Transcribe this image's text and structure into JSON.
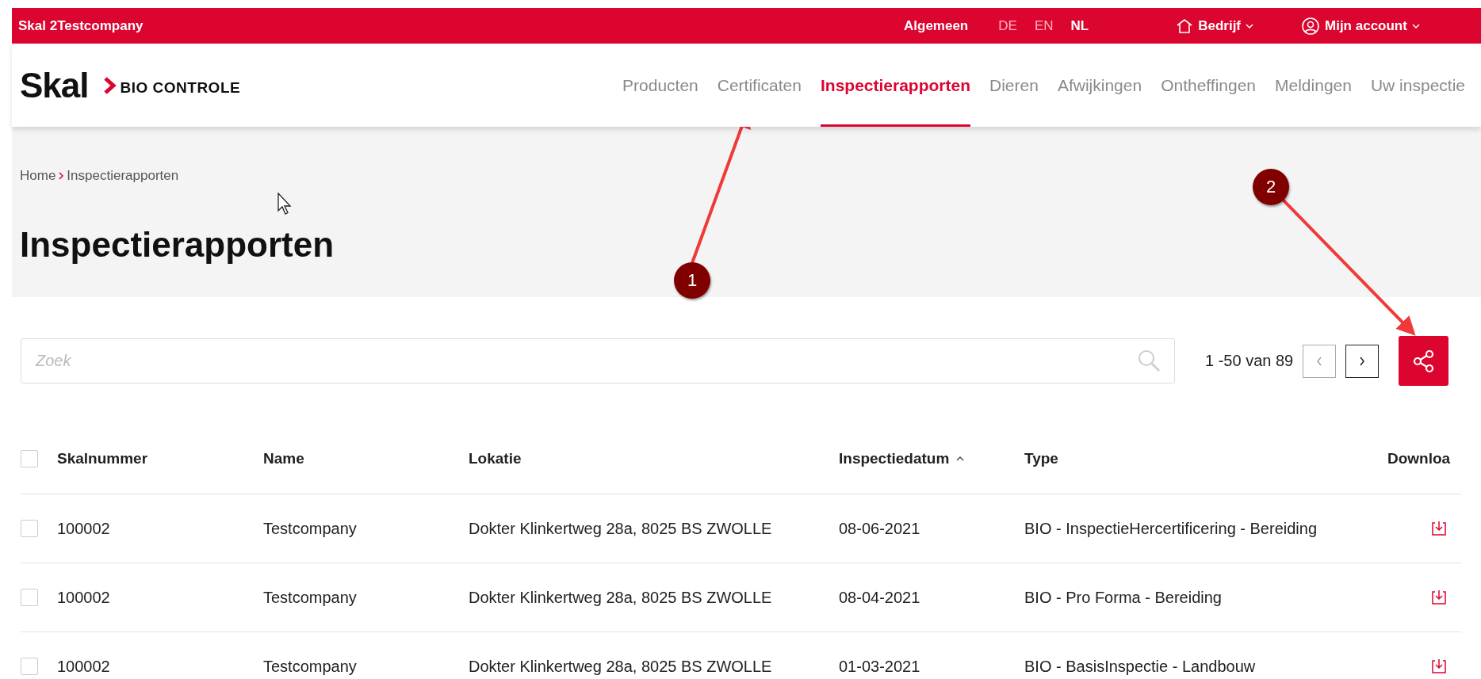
{
  "top_bar": {
    "company": "Skal 2Testcompany",
    "general": "Algemeen",
    "languages": [
      {
        "label": "DE",
        "selected": false
      },
      {
        "label": "EN",
        "selected": false
      },
      {
        "label": "NL",
        "selected": true
      }
    ],
    "company_menu": "Bedrijf",
    "account_menu": "Mijn account"
  },
  "logo": {
    "name": "Skal",
    "tagline": "BIO CONTROLE"
  },
  "nav": [
    {
      "label": "Producten",
      "selected": false
    },
    {
      "label": "Certificaten",
      "selected": false
    },
    {
      "label": "Inspectierapporten",
      "selected": true
    },
    {
      "label": "Dieren",
      "selected": false
    },
    {
      "label": "Afwijkingen",
      "selected": false
    },
    {
      "label": "Ontheffingen",
      "selected": false
    },
    {
      "label": "Meldingen",
      "selected": false
    },
    {
      "label": "Uw inspectie",
      "selected": false
    }
  ],
  "breadcrumb": [
    "Home",
    "Inspectierapporten"
  ],
  "page_title": "Inspectierapporten",
  "search": {
    "placeholder": "Zoek"
  },
  "pagination": {
    "range": "1 -50 van 89"
  },
  "table": {
    "select_all": {
      "checked": false
    },
    "columns": [
      "Skalnummer",
      "Name",
      "Lokatie",
      "Inspectiedatum",
      "Type",
      "Downloa"
    ],
    "rows": [
      {
        "checked": false,
        "cells": [
          "100002",
          "Testcompany",
          "Dokter Klinkertweg 28a, 8025 BS ZWOLLE",
          "08-06-2021",
          "BIO - InspectieHercertificering - Bereiding"
        ]
      },
      {
        "checked": false,
        "cells": [
          "100002",
          "Testcompany",
          "Dokter Klinkertweg 28a, 8025 BS ZWOLLE",
          "08-04-2021",
          "BIO - Pro Forma - Bereiding"
        ]
      },
      {
        "checked": false,
        "cells": [
          "100002",
          "Testcompany",
          "Dokter Klinkertweg 28a, 8025 BS ZWOLLE",
          "01-03-2021",
          "BIO - BasisInspectie - Landbouw"
        ]
      }
    ]
  },
  "annotations": [
    {
      "label": "1"
    },
    {
      "label": "2"
    }
  ]
}
